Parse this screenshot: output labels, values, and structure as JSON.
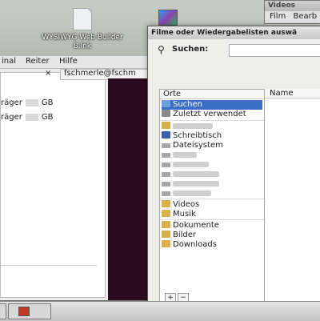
{
  "desktop": {
    "icon_label": "WYSIWYG Web Builder 8.lnk"
  },
  "background_window": {
    "menu": [
      "inal",
      "Reiter",
      "Hilfe"
    ],
    "tab_text": "fschmerle@fschm",
    "tab_close": "×",
    "rows": [
      {
        "prefix": "räger",
        "suffix": "GB"
      },
      {
        "prefix": "räger",
        "suffix": "GB"
      }
    ]
  },
  "videos_window": {
    "title": "Videos",
    "menu": [
      "Film",
      "Bearb"
    ]
  },
  "dialog": {
    "title": "Filme oder Wiedergabelisten auswä",
    "search_label": "Suchen:",
    "search_value": "",
    "places_header": "Orte",
    "name_header": "Name",
    "places": [
      {
        "label": "Suchen",
        "icon": "search-icon",
        "selected": true
      },
      {
        "label": "Zuletzt verwendet",
        "icon": "recent-icon",
        "selected": false
      },
      {
        "label": "",
        "icon": "home-folder-icon",
        "selected": false,
        "blurred": true
      },
      {
        "label": "Schreibtisch",
        "icon": "desktop-icon",
        "selected": false
      },
      {
        "label": "Dateisystem",
        "icon": "drive-icon",
        "selected": false
      },
      {
        "label": "",
        "icon": "drive-icon",
        "selected": false,
        "blurred": true
      },
      {
        "label": "",
        "icon": "drive-icon",
        "selected": false,
        "blurred": true
      },
      {
        "label": "",
        "icon": "drive-icon",
        "selected": false,
        "blurred": true
      },
      {
        "label": "",
        "icon": "drive-icon",
        "selected": false,
        "blurred": true
      },
      {
        "label": "",
        "icon": "drive-icon",
        "selected": false,
        "blurred": true
      },
      {
        "label": "Videos",
        "icon": "folder-icon",
        "selected": false
      },
      {
        "label": "Musik",
        "icon": "folder-icon",
        "selected": false
      },
      {
        "label": "Dokumente",
        "icon": "folder-icon",
        "selected": false
      },
      {
        "label": "Bilder",
        "icon": "folder-icon",
        "selected": false
      },
      {
        "label": "Downloads",
        "icon": "folder-icon",
        "selected": false
      }
    ],
    "add_label": "+",
    "remove_label": "−"
  }
}
